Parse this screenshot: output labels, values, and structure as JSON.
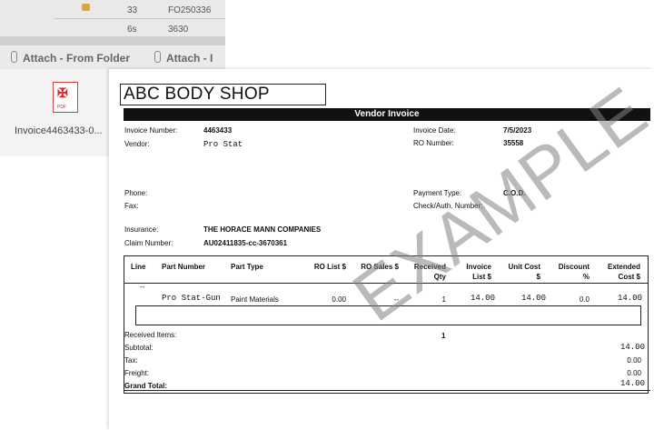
{
  "email": {
    "grid_rows": [
      {
        "num": "33",
        "code": "FO250336"
      },
      {
        "num": "6s",
        "code": "3630"
      }
    ],
    "attach_from_folder": "Attach - From Folder",
    "attach_other": "Attach - I",
    "attachment_name": "Invoice4463433-0..."
  },
  "invoice": {
    "company": "ABC BODY SHOP",
    "title": "Vendor Invoice",
    "labels": {
      "invoice_number": "Invoice Number:",
      "vendor": "Vendor:",
      "invoice_date": "Invoice Date:",
      "ro_number": "RO Number:",
      "phone": "Phone:",
      "fax": "Fax:",
      "payment_type": "Payment Type:",
      "check_auth": "Check/Auth. Number:",
      "insurance": "Insurance:",
      "claim_number": "Claim Number:"
    },
    "values": {
      "invoice_number": "4463433",
      "vendor": "Pro Stat",
      "invoice_date": "7/5/2023",
      "ro_number": "35558",
      "payment_type": "C.O.D.",
      "insurance": "THE HORACE MANN COMPANIES",
      "claim_number": "AU02411835-cc-3670361"
    },
    "columns": {
      "line": "Line",
      "part_number": "Part Number",
      "part_type": "Part Type",
      "ro_list": "RO List $",
      "ro_sales": "RO Sales $",
      "received_qty_1": "Received",
      "received_qty_2": "Qty",
      "invoice_list_1": "Invoice",
      "invoice_list_2": "List $",
      "unit_cost_1": "Unit Cost",
      "unit_cost_2": "$",
      "discount_1": "Discount",
      "discount_2": "%",
      "extended_1": "Extended",
      "extended_2": "Cost $"
    },
    "line_item": {
      "line": "--",
      "part_number": "Pro Stat-Gun",
      "part_type": "Paint Materials",
      "ro_list": "0.00",
      "ro_sales": "--",
      "received_qty": "1",
      "invoice_list": "14.00",
      "unit_cost": "14.00",
      "discount": "0.0",
      "extended": "14.00"
    },
    "totals": {
      "received_items_label": "Received Items:",
      "received_items": "1",
      "subtotal_label": "Subtotal:",
      "subtotal": "14.00",
      "tax_label": "Tax:",
      "tax": "0.00",
      "freight_label": "Freight:",
      "freight": "0.00",
      "grand_total_label": "Grand Total:",
      "grand_total": "14.00"
    },
    "watermark": "EXAMPLE"
  }
}
